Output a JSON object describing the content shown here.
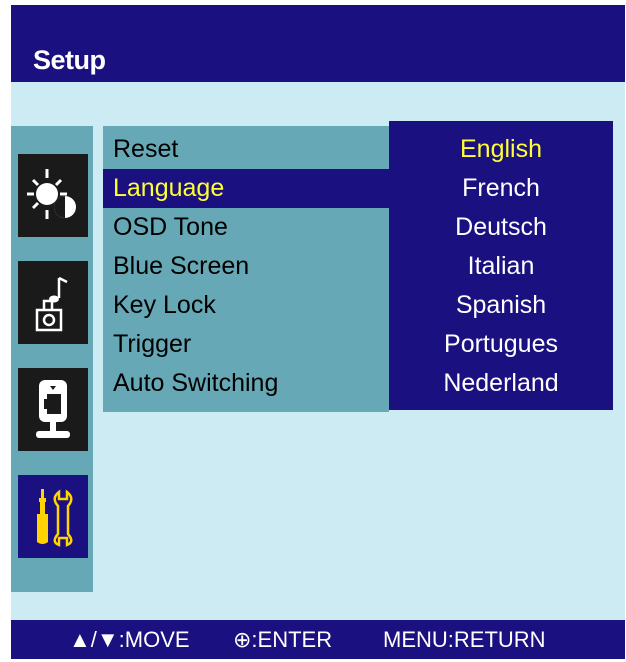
{
  "header": {
    "title": "Setup"
  },
  "sidebar": {
    "items": [
      {
        "icon": "brightness-contrast-icon",
        "selected": false
      },
      {
        "icon": "audio-icon",
        "selected": false
      },
      {
        "icon": "display-position-icon",
        "selected": false
      },
      {
        "icon": "setup-tools-icon",
        "selected": true
      }
    ]
  },
  "menu": {
    "items": [
      {
        "label": "Reset"
      },
      {
        "label": "Language"
      },
      {
        "label": "OSD Tone"
      },
      {
        "label": "Blue Screen"
      },
      {
        "label": "Key Lock"
      },
      {
        "label": "Trigger"
      },
      {
        "label": "Auto Switching"
      }
    ],
    "selected_index": 1
  },
  "options": {
    "items": [
      {
        "label": "English"
      },
      {
        "label": "French"
      },
      {
        "label": "Deutsch"
      },
      {
        "label": "Italian"
      },
      {
        "label": "Spanish"
      },
      {
        "label": "Portugues"
      },
      {
        "label": "Nederland"
      }
    ],
    "selected_index": 0
  },
  "footer": {
    "move": "▲/▼:MOVE",
    "enter": "⊕:ENTER",
    "return": "MENU:RETURN"
  },
  "colors": {
    "header_bg": "#1b1080",
    "panel_bg": "#cdebf2",
    "menu_bg": "#66a8b6",
    "highlight_text": "#ffff33"
  }
}
